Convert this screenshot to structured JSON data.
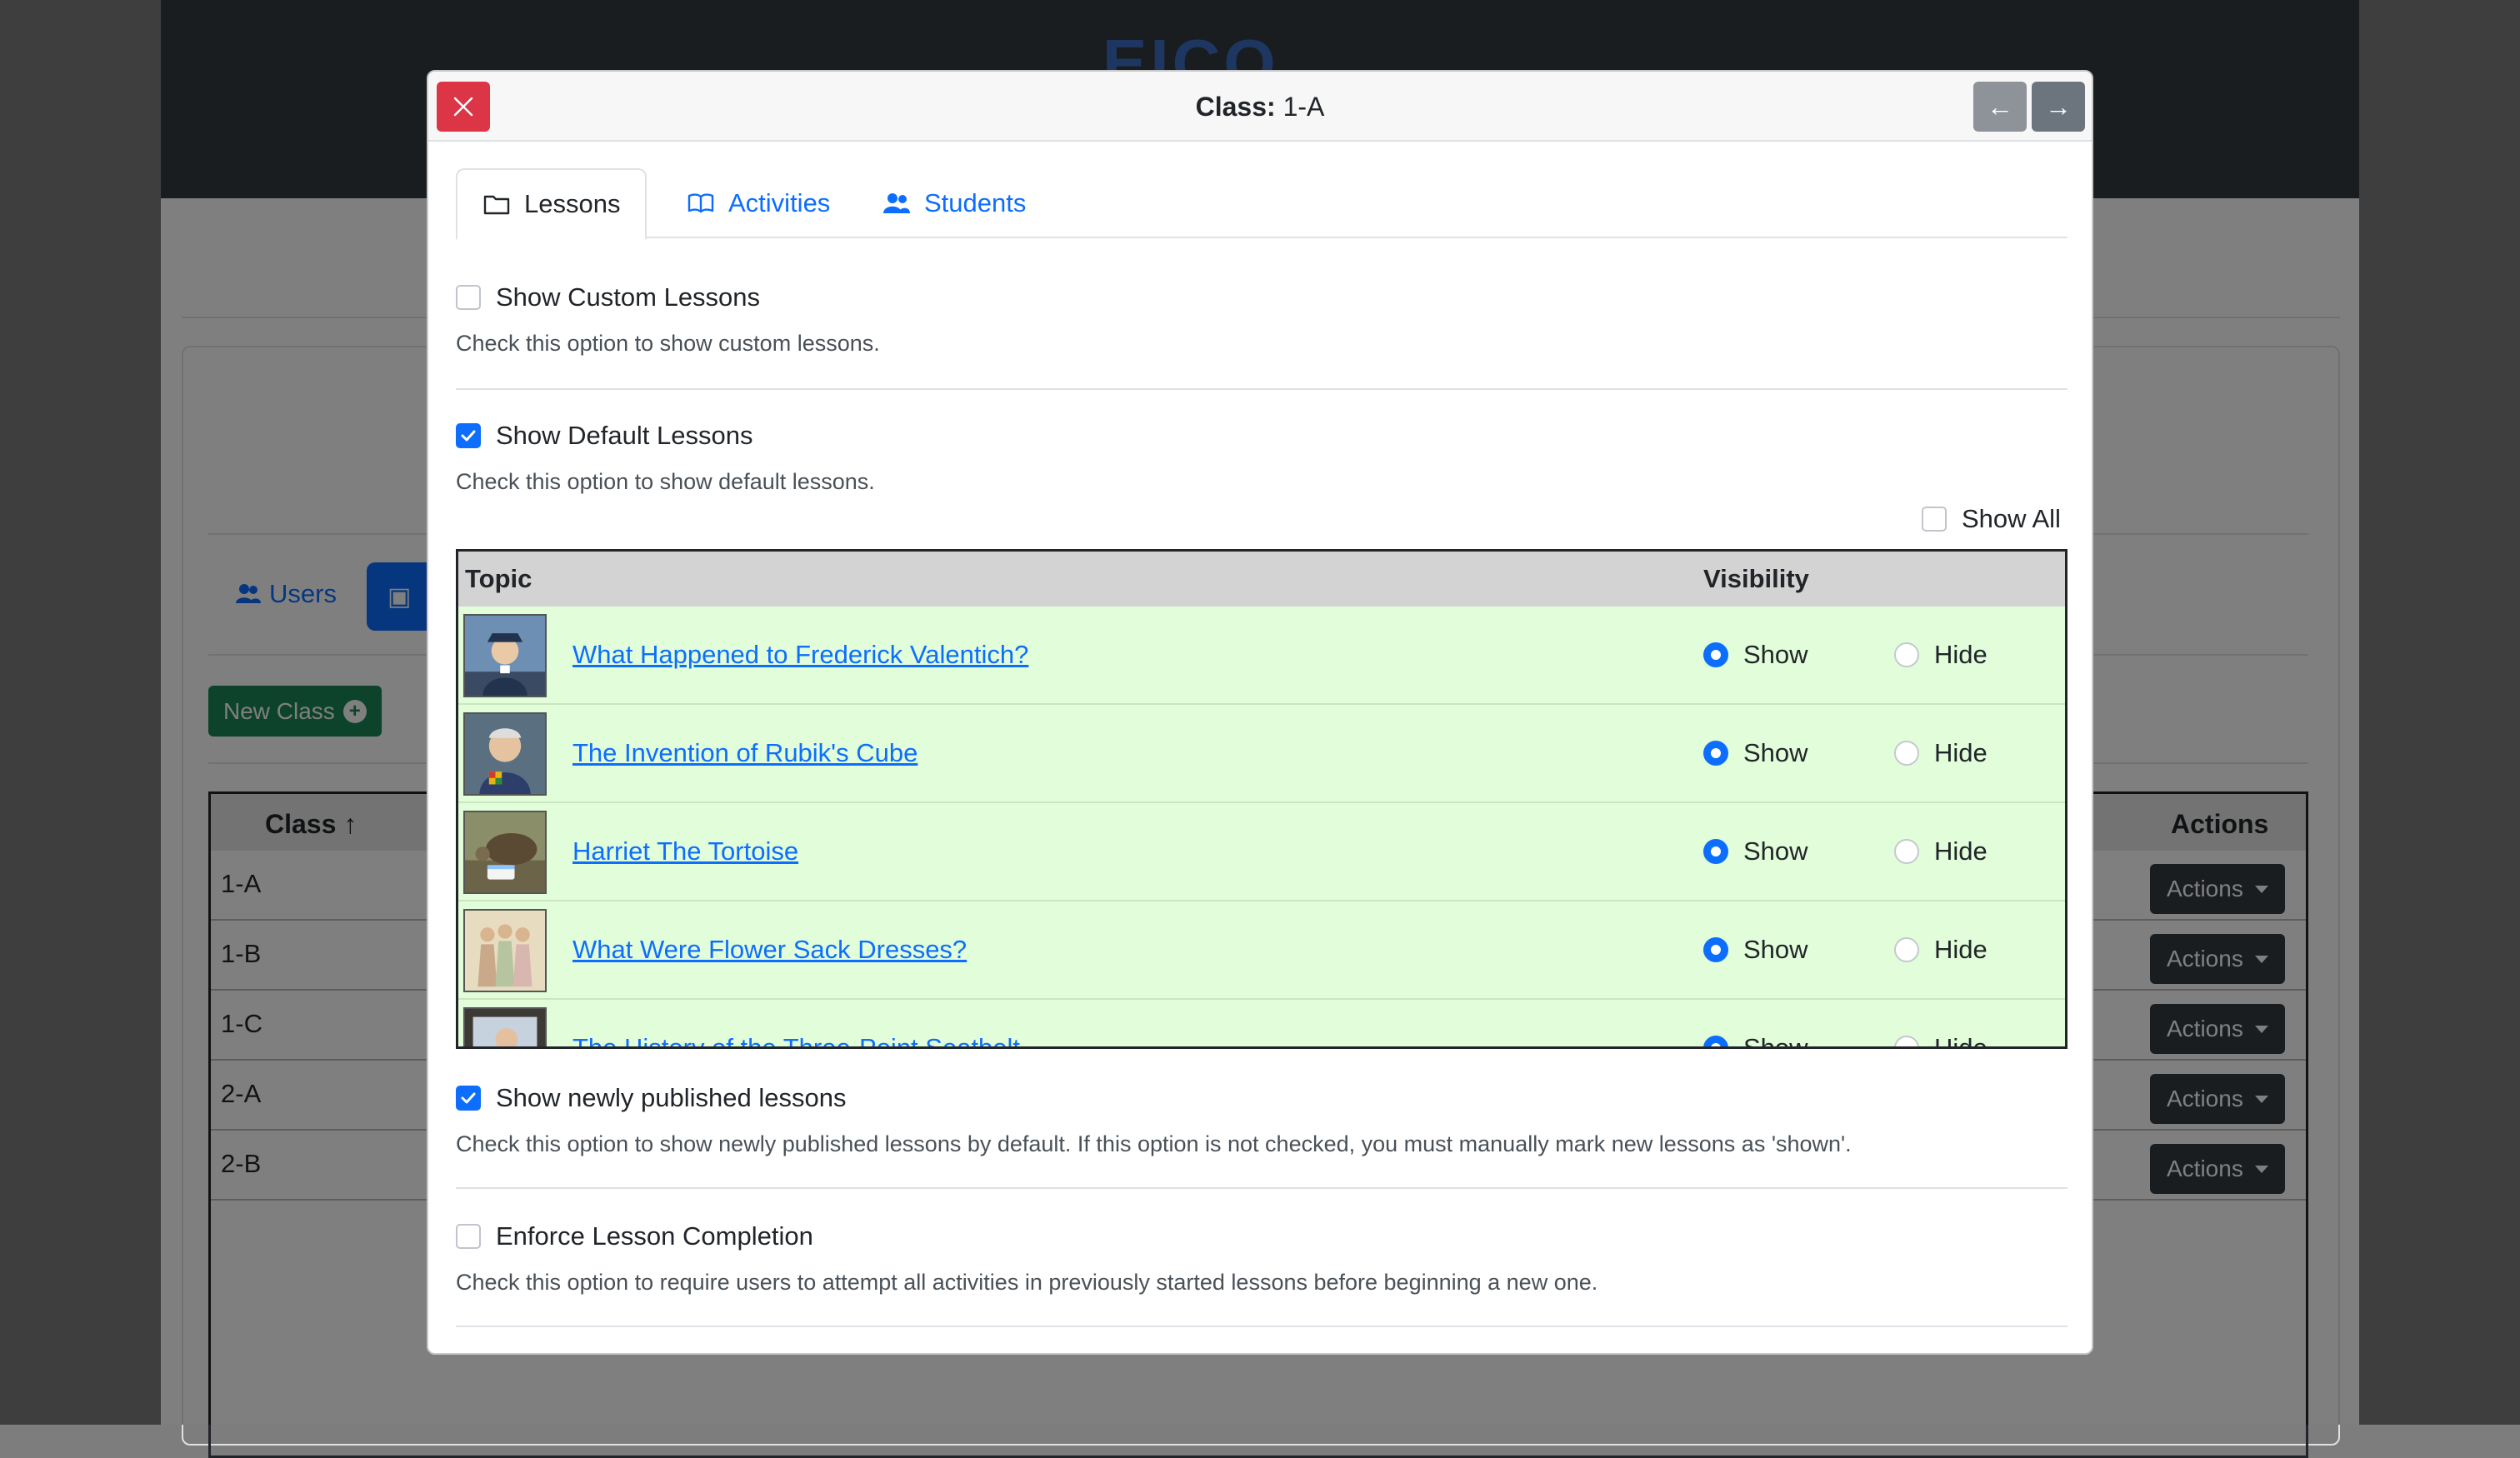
{
  "background": {
    "logo_text": "EICO",
    "users_label": "Users",
    "new_class_label": "New Class",
    "table_headers": {
      "class": "Class",
      "actions": "Actions"
    },
    "classes": [
      {
        "name": "1-A",
        "action": "Actions"
      },
      {
        "name": "1-B",
        "action": "Actions"
      },
      {
        "name": "1-C",
        "action": "Actions"
      },
      {
        "name": "2-A",
        "action": "Actions"
      },
      {
        "name": "2-B",
        "action": "Actions"
      }
    ]
  },
  "modal": {
    "title_prefix": "Class:",
    "title_value": "1-A",
    "prev_icon": "arrow-left-icon",
    "next_icon": "arrow-right-icon",
    "tabs": [
      {
        "label": "Lessons",
        "icon": "folder-icon",
        "active": true
      },
      {
        "label": "Activities",
        "icon": "book-open-icon",
        "active": false
      },
      {
        "label": "Students",
        "icon": "users-icon",
        "active": false
      }
    ],
    "options": {
      "custom": {
        "label": "Show Custom Lessons",
        "help": "Check this option to show custom lessons.",
        "checked": false
      },
      "default": {
        "label": "Show Default Lessons",
        "help": "Check this option to show default lessons.",
        "checked": true
      },
      "show_all": {
        "label": "Show All",
        "checked": false
      },
      "newly": {
        "label": "Show newly published lessons",
        "help": "Check this option to show newly published lessons by default. If this option is not checked, you must manually mark new lessons as 'shown'.",
        "checked": true
      },
      "enforce": {
        "label": "Enforce Lesson Completion",
        "help": "Check this option to require users to attempt all activities in previously started lessons before beginning a new one.",
        "checked": false
      }
    },
    "lesson_table": {
      "headers": {
        "topic": "Topic",
        "visibility": "Visibility"
      },
      "show_label": "Show",
      "hide_label": "Hide",
      "rows": [
        {
          "title": "What Happened to Frederick Valentich?",
          "visibility": "Show"
        },
        {
          "title": "The Invention of Rubik's Cube",
          "visibility": "Show"
        },
        {
          "title": "Harriet The Tortoise",
          "visibility": "Show"
        },
        {
          "title": "What Were Flower Sack Dresses?",
          "visibility": "Show"
        },
        {
          "title": "The History of the Three-Point Seatbelt",
          "visibility": "Show"
        }
      ]
    }
  },
  "colors": {
    "primary": "#0d6efd",
    "danger": "#dc3545",
    "row_bg": "#e1fdd9",
    "success": "#198754"
  }
}
